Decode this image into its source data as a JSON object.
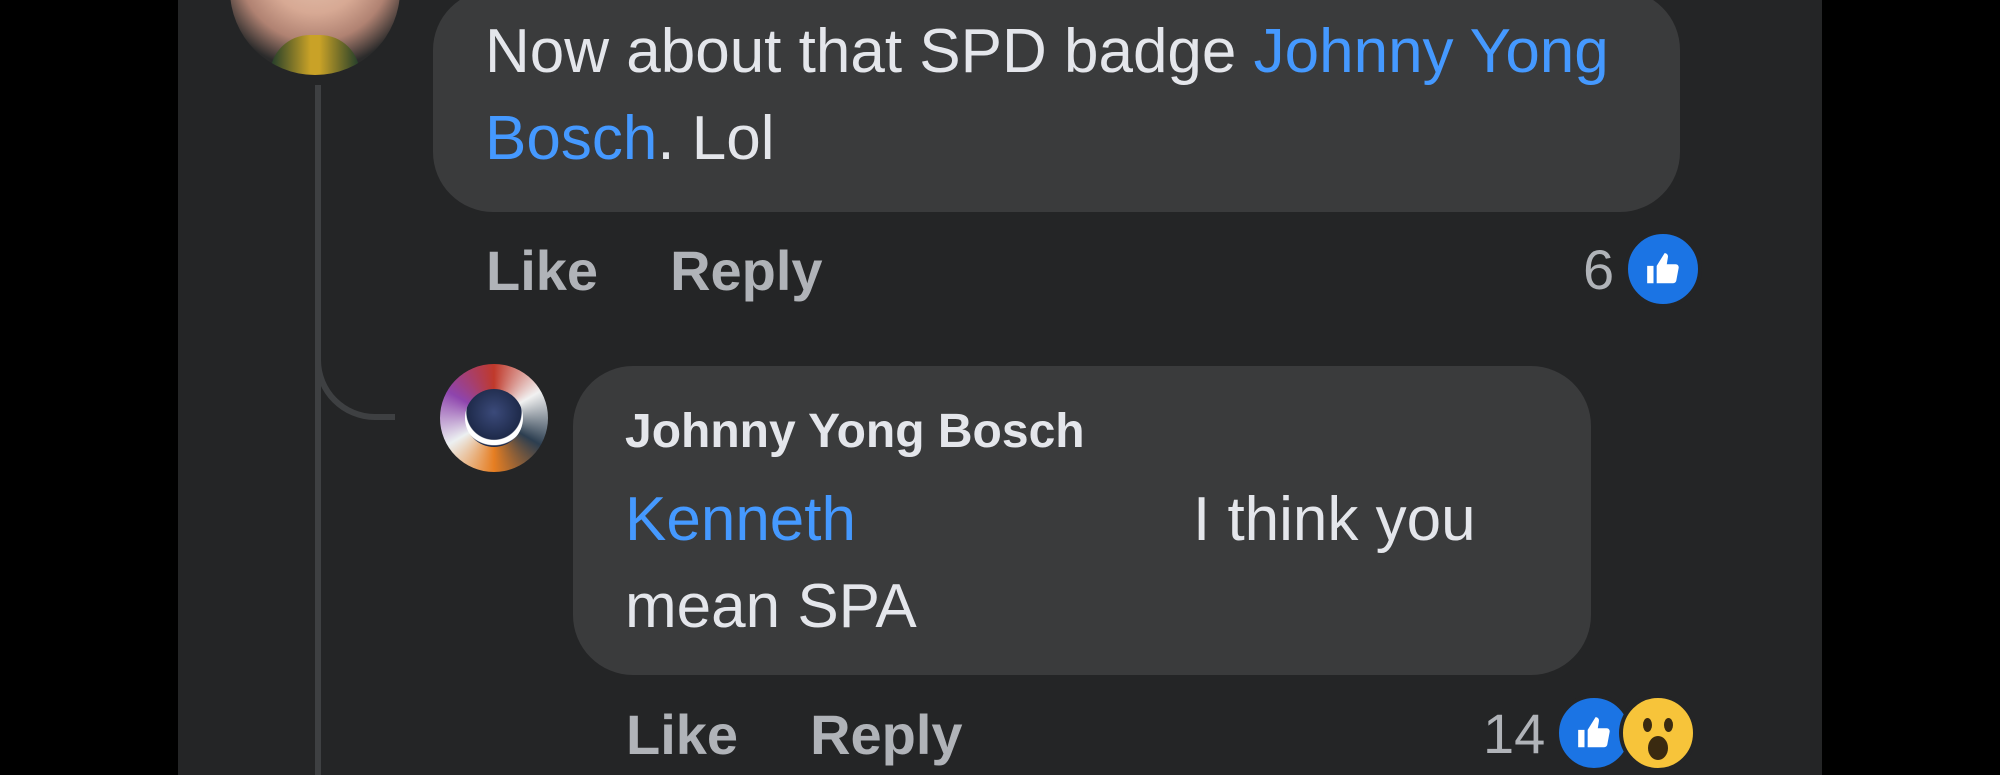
{
  "comments": [
    {
      "text_before": "Now about that SPD badge ",
      "mention": "Johnny Yong Bosch",
      "text_after": ". Lol",
      "actions": {
        "like": "Like",
        "reply": "Reply"
      },
      "reaction_count": "6",
      "reactions": [
        "like-icon"
      ]
    },
    {
      "author": "Johnny Yong Bosch",
      "mention": "Kenneth",
      "text_right": "I think you",
      "text_line2": "mean SPA",
      "actions": {
        "like": "Like",
        "reply": "Reply"
      },
      "reaction_count": "14",
      "reactions": [
        "like-icon",
        "wow-icon"
      ]
    }
  ],
  "colors": {
    "background": "#242526",
    "bubble": "#3a3b3c",
    "text": "#e4e6eb",
    "muted": "#b0b3b8",
    "mention": "#4599ff",
    "like_blue": "#1b74e4",
    "wow_yellow": "#f7c43a"
  }
}
